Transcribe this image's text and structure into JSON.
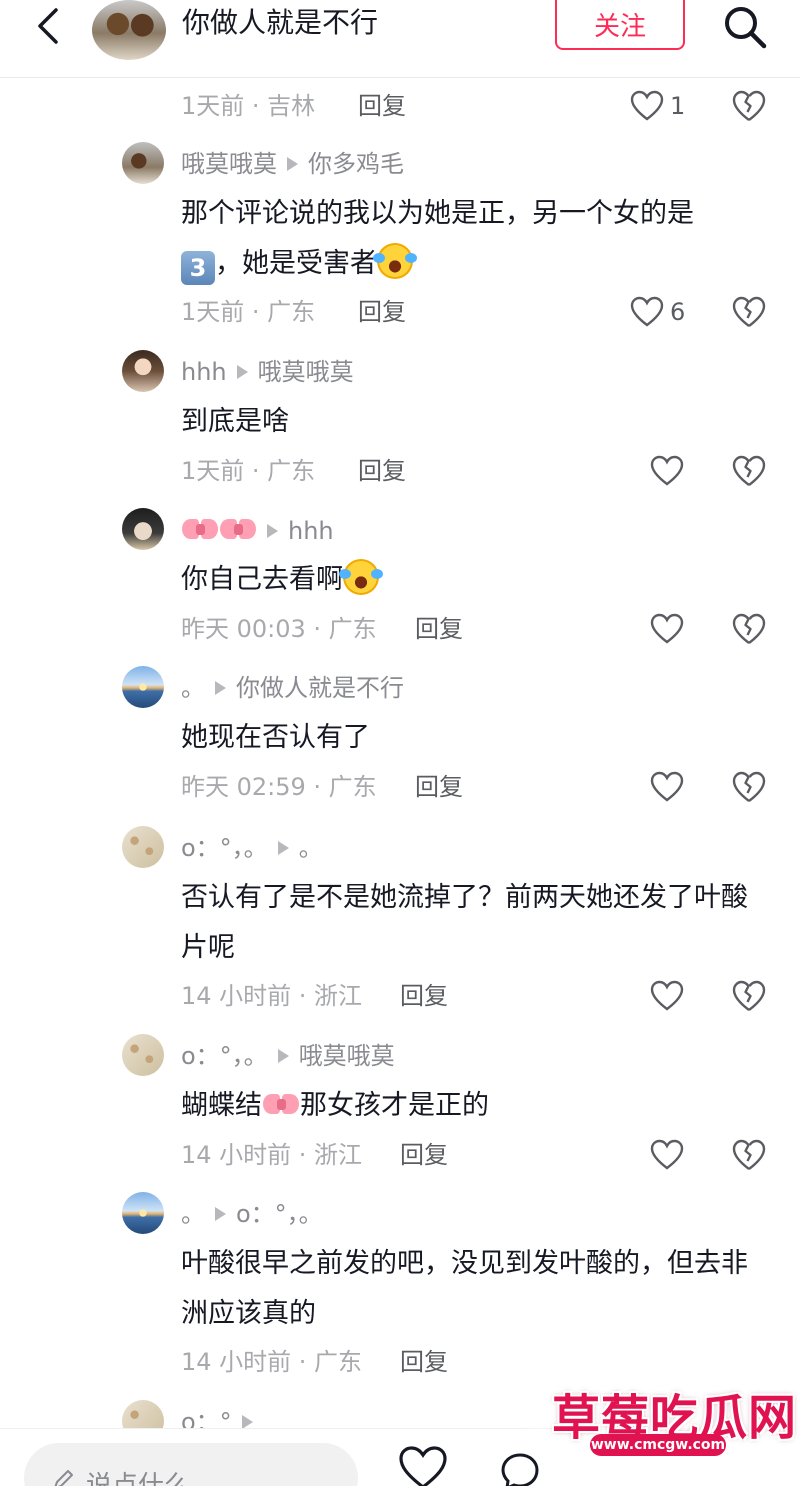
{
  "header": {
    "title": "你做人就是不行",
    "follow_label": "关注"
  },
  "comments": [
    {
      "author": "",
      "reply_to": "",
      "text": "",
      "time_loc": "1天前 · 吉林",
      "reply_label": "回复",
      "likes": "1"
    },
    {
      "author": "哦莫哦莫",
      "reply_to": "你多鸡毛",
      "text": "那个评论说的我以为她是正，另一个女的是",
      "text2": "，她是受害者",
      "keycap": "3",
      "time_loc": "1天前 · 广东",
      "reply_label": "回复",
      "likes": "6"
    },
    {
      "author": "hhh",
      "reply_to": "哦莫哦莫",
      "text": "到底是啥",
      "time_loc": "1天前 · 广东",
      "reply_label": "回复",
      "likes": ""
    },
    {
      "author": "",
      "reply_to": "hhh",
      "text": "你自己去看啊",
      "time_loc": "昨天 00:03 · 广东",
      "reply_label": "回复",
      "likes": ""
    },
    {
      "author": "。",
      "reply_to": "你做人就是不行",
      "text": "她现在否认有了",
      "time_loc": "昨天 02:59 · 广东",
      "reply_label": "回复",
      "likes": ""
    },
    {
      "author": "o：°，。",
      "reply_to": "。",
      "text": "否认有了是不是她流掉了？前两天她还发了叶酸片呢",
      "time_loc": "14 小时前 · 浙江",
      "reply_label": "回复",
      "likes": ""
    },
    {
      "author": "o：°，。",
      "reply_to": "哦莫哦莫",
      "text": "蝴蝶结",
      "text2": "那女孩才是正的",
      "time_loc": "14 小时前 · 浙江",
      "reply_label": "回复",
      "likes": ""
    },
    {
      "author": "。",
      "reply_to": "o：°，。",
      "text": "叶酸很早之前发的吧，没见到发叶酸的，但去非洲应该真的",
      "time_loc": "14 小时前 · 广东",
      "reply_label": "回复",
      "likes": ""
    },
    {
      "author": "o：°",
      "reply_to": "",
      "text": "",
      "time_loc": "",
      "reply_label": "",
      "likes": ""
    }
  ],
  "bottom": {
    "input_placeholder": "说点什么"
  },
  "watermark": {
    "title": "草莓吃瓜网",
    "url": "www.cmcgw.com"
  },
  "colors": {
    "accent": "#fe2c55",
    "meta_gray": "#a8a9ad",
    "name_gray": "#8a8b91"
  },
  "icons": [
    "back-arrow-icon",
    "search-icon",
    "heart-icon",
    "broken-heart-icon",
    "pen-icon",
    "comment-icon",
    "triangle-reply-icon"
  ]
}
